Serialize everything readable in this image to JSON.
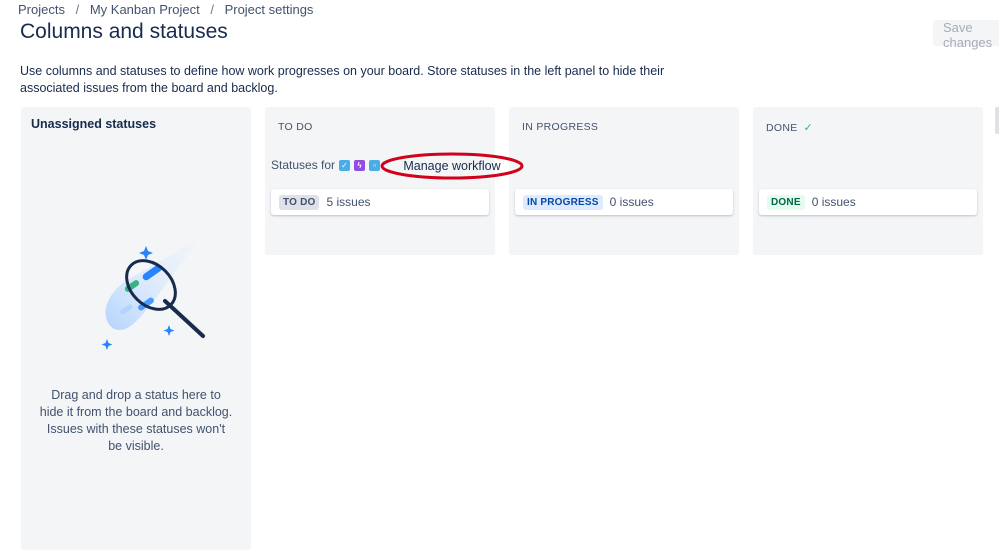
{
  "breadcrumb": {
    "items": [
      "Projects",
      "My Kanban Project",
      "Project settings"
    ],
    "separator": "/"
  },
  "page": {
    "title": "Columns and statuses",
    "save_label": "Save changes",
    "description": "Use columns and statuses to define how work progresses on your board. Store statuses in the left panel to hide their associated issues from the board and backlog."
  },
  "unassigned": {
    "title": "Unassigned statuses",
    "help": "Drag and drop a status here to hide it from the board and backlog. Issues with these statuses won't be visible."
  },
  "statuses_for": {
    "label": "Statuses for",
    "issue_type_icons": [
      "task-icon",
      "epic-icon",
      "subtask-icon"
    ]
  },
  "manage_workflow": "Manage workflow",
  "columns": [
    {
      "name": "TO DO",
      "status": "TO DO",
      "count": "5 issues"
    },
    {
      "name": "IN PROGRESS",
      "status": "IN PROGRESS",
      "count": "0 issues"
    },
    {
      "name": "DONE",
      "status": "DONE",
      "count": "0 issues",
      "done_check": "✓"
    }
  ],
  "colors": {
    "accent": "#0052cc",
    "highlight_ring": "#d0021b",
    "done_green": "#36b37e",
    "panel_bg": "#f4f5f7"
  }
}
